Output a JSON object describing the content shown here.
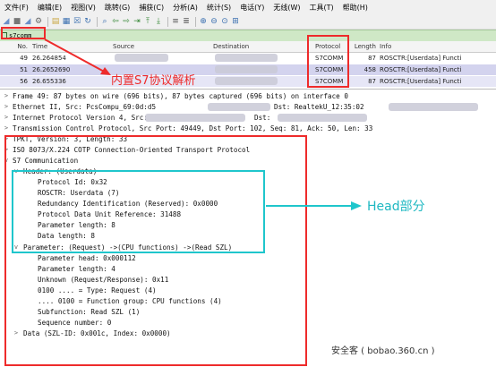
{
  "menu": [
    "文件(F)",
    "编辑(E)",
    "视图(V)",
    "跳转(G)",
    "捕获(C)",
    "分析(A)",
    "统计(S)",
    "电话(Y)",
    "无线(W)",
    "工具(T)",
    "帮助(H)"
  ],
  "filter": {
    "value": "s7comm"
  },
  "columns": {
    "no": "No.",
    "time": "Time",
    "source": "Source",
    "destination": "Destination",
    "protocol": "Protocol",
    "length": "Length",
    "info": "Info"
  },
  "packets": [
    {
      "no": "49",
      "time": "26.264854",
      "protocol": "S7COMM",
      "length": "87",
      "info": "ROSCTR:[Userdata] Functi"
    },
    {
      "no": "51",
      "time": "26.2652690",
      "protocol": "S7COMM",
      "length": "458",
      "info": "ROSCTR:[Userdata] Functi"
    },
    {
      "no": "56",
      "time": "26.655336",
      "protocol": "S7COMM",
      "length": "87",
      "info": "ROSCTR:[Userdata] Functi"
    }
  ],
  "details": [
    "Frame 49: 87 bytes on wire (696 bits), 87 bytes captured (696 bits) on interface 0",
    "Ethernet II, Src: PcsCompu_69:0d:d5",
    "Dst: RealtekU_12:35:02",
    "Internet Protocol Version 4, Src:",
    "Dst:",
    "Transmission Control Protocol, Src Port: 49449, Dst Port: 102, Seq: 81, Ack: 50, Len: 33",
    "TPKT, Version: 3, Length: 33",
    "ISO 8073/X.224 COTP Connection-Oriented Transport Protocol",
    "S7 Communication",
    "Header: (Userdata)",
    "Protocol Id: 0x32",
    "ROSCTR: Userdata (7)",
    "Redundancy Identification (Reserved): 0x0000",
    "Protocol Data Unit Reference: 31488",
    "Parameter length: 8",
    "Data length: 8",
    "Parameter: (Request) ->(CPU functions) ->(Read SZL)",
    "Parameter head: 0x000112",
    "Parameter length: 4",
    "Unknown (Request/Response): 0x11",
    "0100 .... = Type: Request (4)",
    ".... 0100 = Function group: CPU functions (4)",
    "Subfunction: Read SZL (1)",
    "Sequence number: 0",
    "Data (SZL-ID: 0x001c, Index: 0x0000)"
  ],
  "annotations": {
    "s7_label": "内置S7协议解析",
    "head_label": "Head部分"
  },
  "watermark": "安全客 ( bobao.360.cn )",
  "colors": {
    "annotation_red": "#ee2b2b",
    "annotation_cyan": "#1fc6cc",
    "filter_bg": "#cfe8c6",
    "selected_row": "#d3d3ee"
  }
}
